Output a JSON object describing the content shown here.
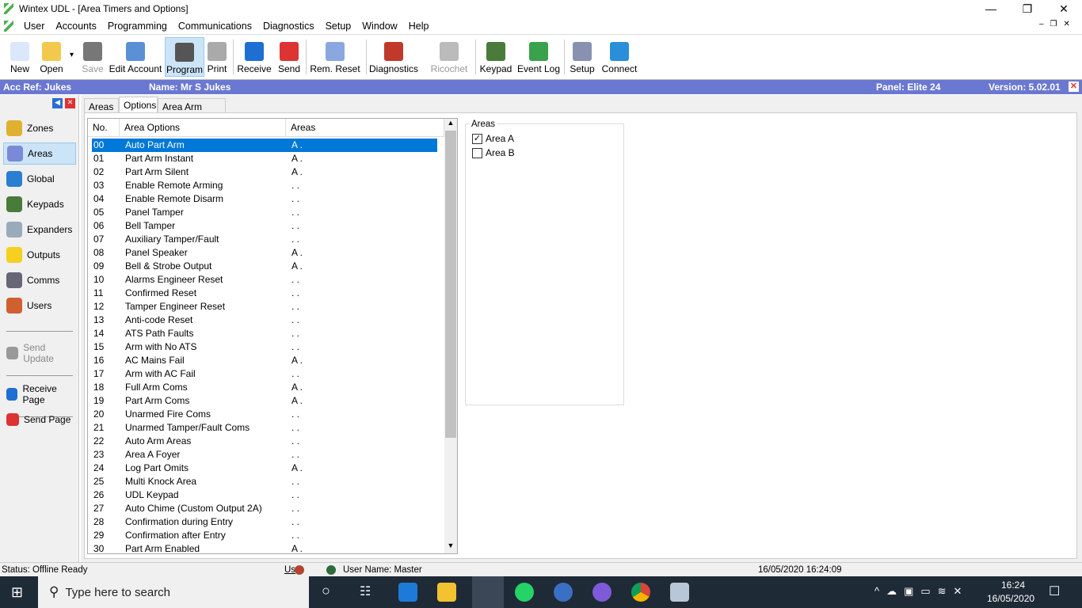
{
  "window": {
    "title": "Wintex UDL - [Area Timers and Options]"
  },
  "menu": [
    "User",
    "Accounts",
    "Programming",
    "Communications",
    "Diagnostics",
    "Setup",
    "Window",
    "Help"
  ],
  "toolbar": [
    {
      "label": "New",
      "icon": "new-file-icon",
      "color": "#dbe8fb"
    },
    {
      "label": "Open",
      "icon": "open-folder-icon",
      "color": "#f2c94c"
    },
    {
      "label": "Save",
      "icon": "save-disk-icon",
      "color": "#777"
    },
    {
      "label": "Edit Account",
      "icon": "edit-account-icon",
      "color": "#5b8fd6"
    },
    {
      "label": "Program",
      "icon": "chip-icon",
      "color": "#555"
    },
    {
      "label": "Print",
      "icon": "printer-icon",
      "color": "#aaa"
    },
    {
      "label": "Receive",
      "icon": "receive-icon",
      "color": "#1e6fd1"
    },
    {
      "label": "Send",
      "icon": "send-icon",
      "color": "#d33"
    },
    {
      "label": "Rem. Reset",
      "icon": "calculator-icon",
      "color": "#8aa7e0"
    },
    {
      "label": "Diagnostics",
      "icon": "tools-icon",
      "color": "#c0392b"
    },
    {
      "label": "Ricochet",
      "icon": "ricochet-icon",
      "color": "#bbb"
    },
    {
      "label": "Keypad",
      "icon": "keypad-icon",
      "color": "#4a7b3a"
    },
    {
      "label": "Event Log",
      "icon": "clock-icon",
      "color": "#3aa24a"
    },
    {
      "label": "Setup",
      "icon": "setup-icon",
      "color": "#8892b0"
    },
    {
      "label": "Connect",
      "icon": "globe-icon",
      "color": "#2a8fd8"
    }
  ],
  "info": {
    "acc_ref": "Acc Ref: Jukes",
    "name": "Name: Mr S Jukes",
    "panel": "Panel: Elite 24",
    "version": "Version: 5.02.01"
  },
  "sidebar": {
    "items": [
      {
        "label": "Zones",
        "icon": "lock-icon",
        "color": "#e0b030"
      },
      {
        "label": "Areas",
        "icon": "areas-icon",
        "color": "#7a8ad8"
      },
      {
        "label": "Global",
        "icon": "globe-icon",
        "color": "#2a7fd0"
      },
      {
        "label": "Keypads",
        "icon": "keypad-icon",
        "color": "#4a7b3a"
      },
      {
        "label": "Expanders",
        "icon": "expander-icon",
        "color": "#9ab"
      },
      {
        "label": "Outputs",
        "icon": "bulb-icon",
        "color": "#f5d020"
      },
      {
        "label": "Comms",
        "icon": "comms-icon",
        "color": "#667"
      },
      {
        "label": "Users",
        "icon": "users-icon",
        "color": "#d06030"
      }
    ],
    "send_update": "Send Update",
    "receive_page": "Receive Page",
    "send_page": "Send Page"
  },
  "tabs": [
    "Areas",
    "Options",
    "Area Arm Suites"
  ],
  "list": {
    "headers": [
      "No.",
      "Area Options",
      "Areas"
    ],
    "rows": [
      [
        "00",
        "Auto Part Arm",
        "A ."
      ],
      [
        "01",
        "Part Arm Instant",
        "A ."
      ],
      [
        "02",
        "Part Arm Silent",
        "A ."
      ],
      [
        "03",
        "Enable Remote Arming",
        ". ."
      ],
      [
        "04",
        "Enable Remote Disarm",
        ". ."
      ],
      [
        "05",
        "Panel Tamper",
        ". ."
      ],
      [
        "06",
        "Bell Tamper",
        ". ."
      ],
      [
        "07",
        "Auxiliary Tamper/Fault",
        ". ."
      ],
      [
        "08",
        "Panel Speaker",
        "A ."
      ],
      [
        "09",
        "Bell & Strobe Output",
        "A ."
      ],
      [
        "10",
        "Alarms Engineer Reset",
        ". ."
      ],
      [
        "11",
        "Confirmed Reset",
        ". ."
      ],
      [
        "12",
        "Tamper Engineer Reset",
        ". ."
      ],
      [
        "13",
        "Anti-code Reset",
        ". ."
      ],
      [
        "14",
        "ATS Path Faults",
        ". ."
      ],
      [
        "15",
        "Arm with No ATS",
        ". ."
      ],
      [
        "16",
        "AC Mains Fail",
        "A ."
      ],
      [
        "17",
        "Arm with AC Fail",
        ". ."
      ],
      [
        "18",
        "Full Arm Coms",
        "A ."
      ],
      [
        "19",
        "Part Arm Coms",
        "A ."
      ],
      [
        "20",
        "Unarmed Fire Coms",
        ". ."
      ],
      [
        "21",
        "Unarmed Tamper/Fault Coms",
        ". ."
      ],
      [
        "22",
        "Auto Arm Areas",
        ". ."
      ],
      [
        "23",
        "Area A Foyer",
        ". ."
      ],
      [
        "24",
        "Log Part Omits",
        "A ."
      ],
      [
        "25",
        "Multi Knock Area",
        ". ."
      ],
      [
        "26",
        "UDL Keypad",
        ". ."
      ],
      [
        "27",
        "Auto Chime (Custom Output 2A)",
        ". ."
      ],
      [
        "28",
        "Confirmation during Entry",
        ". ."
      ],
      [
        "29",
        "Confirmation after Entry",
        ". ."
      ],
      [
        "30",
        "Part Arm Enabled",
        "A ."
      ]
    ]
  },
  "areas_group": {
    "title": "Areas",
    "items": [
      {
        "label": "Area A",
        "checked": true
      },
      {
        "label": "Area B",
        "checked": false
      }
    ]
  },
  "status": {
    "text": "Status: Offline Ready",
    "us": "Us",
    "user": "User Name: Master",
    "datetime": "16/05/2020 16:24:09"
  },
  "taskbar": {
    "search_placeholder": "Type here to search",
    "time": "16:24",
    "date": "16/05/2020"
  }
}
